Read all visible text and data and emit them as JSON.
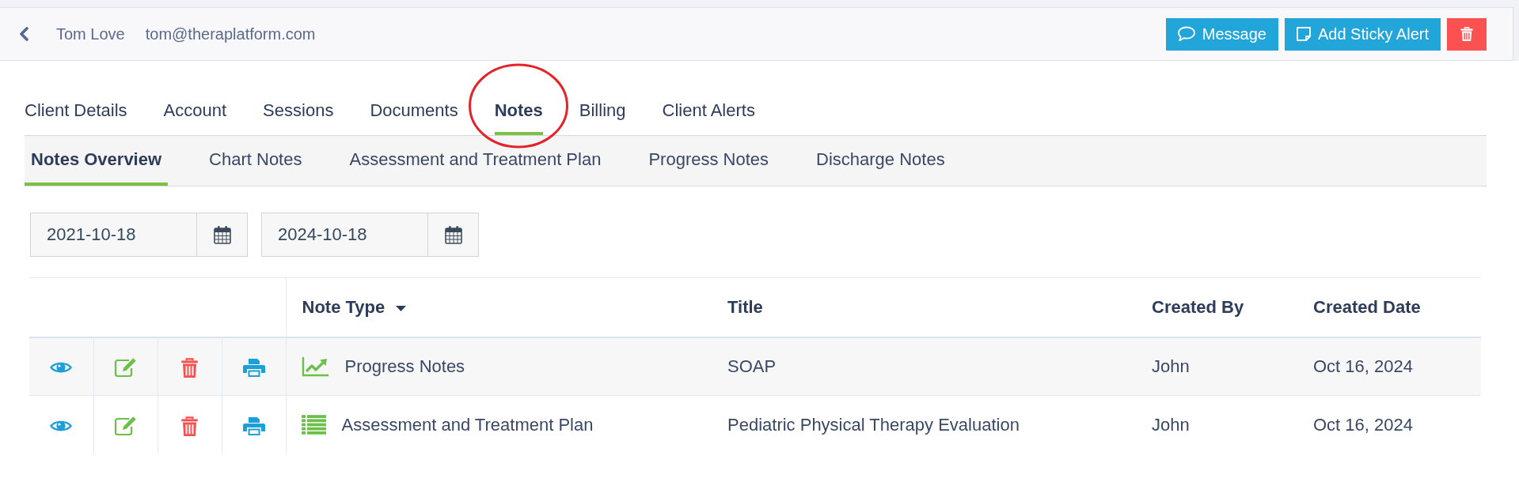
{
  "header": {
    "client_name": "Tom Love",
    "client_email": "tom@theraplatform.com",
    "buttons": [
      {
        "kind": "message",
        "label": "Message"
      },
      {
        "kind": "sticky_alert",
        "label": "Add Sticky Alert"
      },
      {
        "kind": "delete"
      }
    ]
  },
  "tabs": [
    {
      "label": "Client Details",
      "selected": false,
      "circled": false
    },
    {
      "label": "Account",
      "selected": false,
      "circled": false
    },
    {
      "label": "Sessions",
      "selected": false,
      "circled": false
    },
    {
      "label": "Documents",
      "selected": false,
      "circled": false
    },
    {
      "label": "Notes",
      "selected": true,
      "circled": true
    },
    {
      "label": "Billing",
      "selected": false,
      "circled": false
    },
    {
      "label": "Client Alerts",
      "selected": false,
      "circled": false
    }
  ],
  "subtabs": [
    {
      "label": "Notes Overview",
      "selected": true
    },
    {
      "label": "Chart Notes",
      "selected": false
    },
    {
      "label": "Assessment and Treatment Plan",
      "selected": false
    },
    {
      "label": "Progress Notes",
      "selected": false
    },
    {
      "label": "Discharge Notes",
      "selected": false
    }
  ],
  "date_range": [
    {
      "value": "2021-10-18"
    },
    {
      "value": "2024-10-18"
    }
  ],
  "table": {
    "columns": [
      {
        "label": "Note Type",
        "sorted": true
      },
      {
        "label": "Title",
        "sorted": false
      },
      {
        "label": "Created By",
        "sorted": false
      },
      {
        "label": "Created Date",
        "sorted": false
      }
    ],
    "rows": [
      {
        "kind": "progress",
        "note_type": "Progress Notes",
        "title": "SOAP",
        "created_by": "John",
        "created_date": "Oct 16, 2024"
      },
      {
        "kind": "assessment",
        "note_type": "Assessment and Treatment Plan",
        "title": "Pediatric Physical Therapy Evaluation",
        "created_by": "John",
        "created_date": "Oct 16, 2024"
      }
    ]
  }
}
